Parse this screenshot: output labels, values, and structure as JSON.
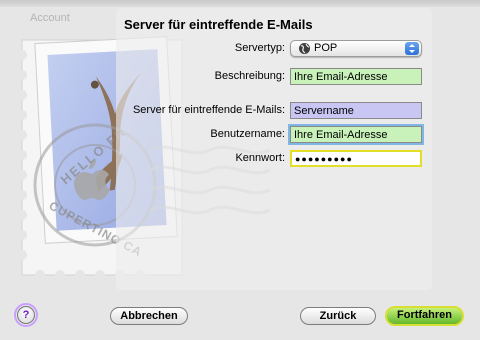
{
  "window": {
    "partial_title": "Account"
  },
  "section": {
    "title": "Server für eintreffende E-Mails"
  },
  "form": {
    "servertyp_label": "Servertyp:",
    "servertyp_value": "POP",
    "beschreibung_label": "Beschreibung:",
    "beschreibung_value": "Ihre Email-Adresse",
    "server_label": "Server für eintreffende E-Mails:",
    "server_value": "Servername",
    "benutzername_label": "Benutzername:",
    "benutzername_value": "Ihre Email-Adresse",
    "kennwort_label": "Kennwort:",
    "kennwort_value": "●●●●●●●●●"
  },
  "stamp": {
    "text_top": "HELLO FR",
    "text_bottom": "CUPERTINO CA"
  },
  "buttons": {
    "help": "?",
    "cancel": "Abbrechen",
    "back": "Zurück",
    "continue": "Fortfahren"
  },
  "colors": {
    "beschreibung_bg": "#c8f2b9",
    "server_bg": "#c9c6f4",
    "benutzername_bg": "#c8f2b9",
    "kennwort_border": "#e3df28",
    "accent_blue": "#2d6fd6"
  }
}
